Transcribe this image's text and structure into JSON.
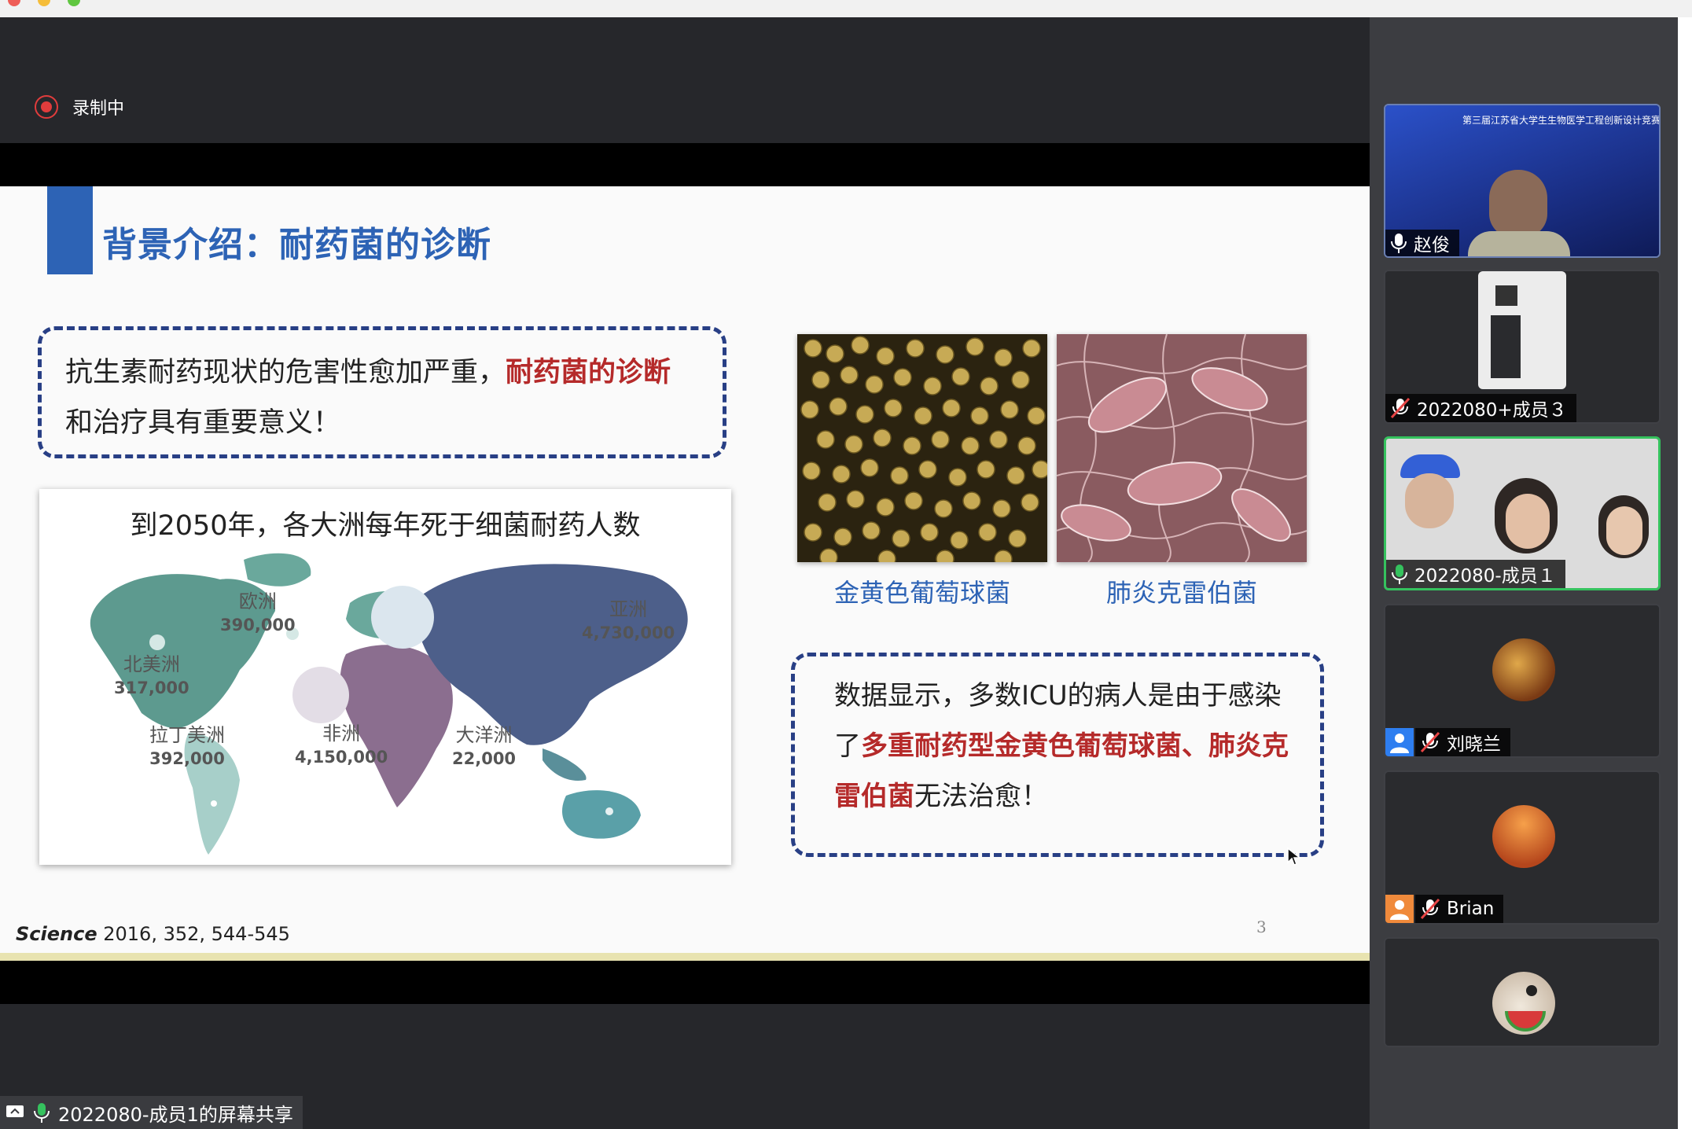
{
  "window": {
    "title": ""
  },
  "recording": {
    "label": "录制中"
  },
  "slide": {
    "title": "背景介绍：耐药菌的诊断",
    "box1": {
      "text_a": "抗生素耐药现状的危害性愈加严重，",
      "text_red": "耐药菌的诊断",
      "text_b": "和治疗具有重要意义！"
    },
    "map": {
      "title": "到2050年，各大洲每年死于细菌耐药人数",
      "regions": [
        {
          "name": "欧洲",
          "value": "390,000"
        },
        {
          "name": "亚洲",
          "value": "4,730,000"
        },
        {
          "name": "北美洲",
          "value": "317,000"
        },
        {
          "name": "拉丁美洲",
          "value": "392,000"
        },
        {
          "name": "非洲",
          "value": "4,150,000"
        },
        {
          "name": "大洋洲",
          "value": "22,000"
        }
      ]
    },
    "photos": [
      {
        "caption": "金黄色葡萄球菌"
      },
      {
        "caption": "肺炎克雷伯菌"
      }
    ],
    "box2": {
      "text_a": "数据显示，多数ICU的病人是由于感染了",
      "text_red": "多重耐药型金黄色葡萄球菌、肺炎克雷伯菌",
      "text_b": "无法治愈！"
    },
    "citation": {
      "journal": "Science",
      "ref": " 2016, 352, 544-545"
    },
    "page_number": "3"
  },
  "share": {
    "label": "2022080-成员1的屏幕共享"
  },
  "participants": [
    {
      "name": "赵俊",
      "mic": "on",
      "banner": "第三届江苏省大学生生物医学工程创新设计竞赛"
    },
    {
      "name": "2022080+成员３",
      "mic": "muted"
    },
    {
      "name": "2022080-成员１",
      "mic": "on",
      "active": true
    },
    {
      "name": "刘晓兰",
      "mic": "muted",
      "badge": "blue"
    },
    {
      "name": "Brian",
      "mic": "muted",
      "badge": "orange"
    },
    {
      "name": "",
      "mic": ""
    }
  ]
}
